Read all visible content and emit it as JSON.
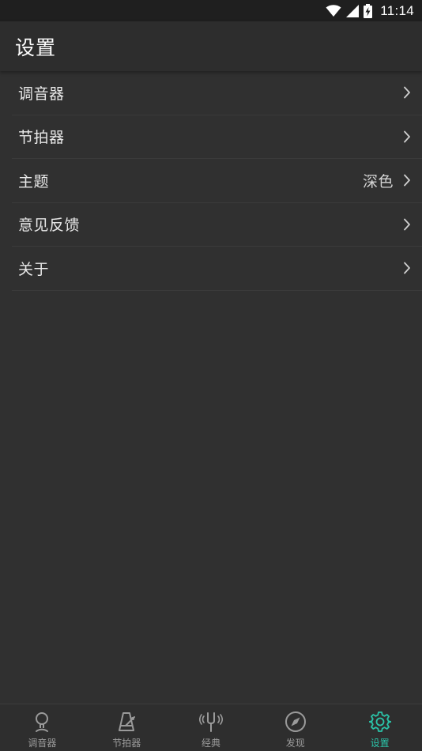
{
  "status_bar": {
    "time": "11:14",
    "icons": [
      "wifi-icon",
      "cellular-signal-icon",
      "battery-charging-icon"
    ]
  },
  "app_bar": {
    "title": "设置"
  },
  "settings": {
    "items": [
      {
        "label": "调音器",
        "value": ""
      },
      {
        "label": "节拍器",
        "value": ""
      },
      {
        "label": "主题",
        "value": "深色"
      },
      {
        "label": "意见反馈",
        "value": ""
      },
      {
        "label": "关于",
        "value": ""
      }
    ]
  },
  "bottom_nav": {
    "items": [
      {
        "label": "调音器",
        "icon": "tuner-icon",
        "active": false
      },
      {
        "label": "节拍器",
        "icon": "metronome-icon",
        "active": false
      },
      {
        "label": "经典",
        "icon": "tuning-fork-icon",
        "active": false
      },
      {
        "label": "发现",
        "icon": "compass-icon",
        "active": false
      },
      {
        "label": "设置",
        "icon": "gear-icon",
        "active": true
      }
    ]
  },
  "colors": {
    "background": "#303030",
    "app_bar": "#2d2d2d",
    "status_bar": "#1f1f1f",
    "accent": "#2bc3a8",
    "inactive_nav": "#9a9a9a"
  }
}
